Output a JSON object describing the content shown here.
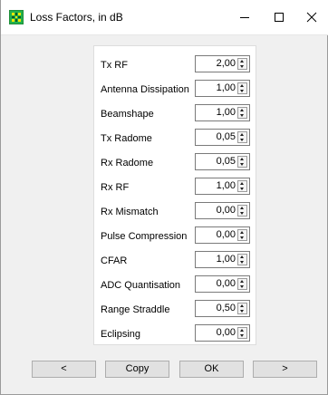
{
  "window": {
    "title": "Loss Factors, in dB",
    "icon": "grid-app-icon",
    "controls": [
      "minimize-icon",
      "maximize-icon",
      "close-icon"
    ]
  },
  "factors": [
    {
      "label": "Tx RF",
      "value": "2,00"
    },
    {
      "label": "Antenna Dissipation",
      "value": "1,00"
    },
    {
      "label": "Beamshape",
      "value": "1,00"
    },
    {
      "label": "Tx Radome",
      "value": "0,05"
    },
    {
      "label": "Rx Radome",
      "value": "0,05"
    },
    {
      "label": "Rx RF",
      "value": "1,00"
    },
    {
      "label": "Rx Mismatch",
      "value": "0,00"
    },
    {
      "label": "Pulse Compression",
      "value": "0,00"
    },
    {
      "label": "CFAR",
      "value": "1,00"
    },
    {
      "label": "ADC Quantisation",
      "value": "0,00"
    },
    {
      "label": "Range Straddle",
      "value": "0,50"
    },
    {
      "label": "Eclipsing",
      "value": "0,00"
    }
  ],
  "buttons": {
    "prev": "<",
    "copy": "Copy",
    "ok": "OK",
    "next": ">"
  },
  "colors": {
    "icon_green": "#22b14c",
    "icon_yellow": "#f2e600"
  }
}
